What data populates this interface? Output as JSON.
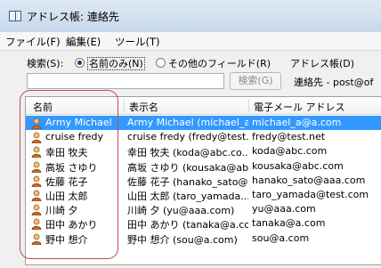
{
  "window": {
    "title": "アドレス帳: 連絡先"
  },
  "menu": [
    "ファイル(F)",
    "編集(E)",
    "ツール(T)"
  ],
  "search": {
    "label": "検索(S):",
    "option_name": "名前のみ(N)",
    "option_other": "その他のフィールド(R)",
    "addressbook_label": "アドレス帳(D)",
    "input_value": "",
    "button_label": "検索(G)",
    "addressbook_value": "連絡先 - post@of"
  },
  "columns": [
    "名前",
    "表示名",
    "電子メール アドレス"
  ],
  "rows": [
    {
      "name": "Army Michael",
      "display": "Army Michael (michael_a...",
      "email": "michael_a@a.com",
      "selected": true
    },
    {
      "name": "cruise fredy",
      "display": "cruise fredy (fredy@test....",
      "email": "fredy@test.net"
    },
    {
      "name": "幸田 牧夫",
      "display": "幸田 牧夫 (koda@abc.co...",
      "email": "koda@abc.com"
    },
    {
      "name": "高坂 さゆり",
      "display": "高坂 さゆり (kousaka@abc...",
      "email": "kousaka@abc.com"
    },
    {
      "name": "佐藤 花子",
      "display": "佐藤 花子 (hanako_sato@...",
      "email": "hanako_sato@aaa.com"
    },
    {
      "name": "山田 太郎",
      "display": "山田 太郎 (taro_yamada...",
      "email": "taro_yamada@test.com"
    },
    {
      "name": "川崎 夕",
      "display": "川崎 夕 (yu@aaa.com)",
      "email": "yu@aaa.com"
    },
    {
      "name": "田中 あかり",
      "display": "田中 あかり (tanaka@a.co...",
      "email": "tanaka@a.com"
    },
    {
      "name": "野中 想介",
      "display": "野中 想介 (sou@a.com)",
      "email": "sou@a.com"
    }
  ],
  "colors": {
    "selection": "#3399ff",
    "annotation": "#c05050"
  },
  "icons": {
    "contact": "person-icon",
    "window": "addressbook-icon"
  }
}
